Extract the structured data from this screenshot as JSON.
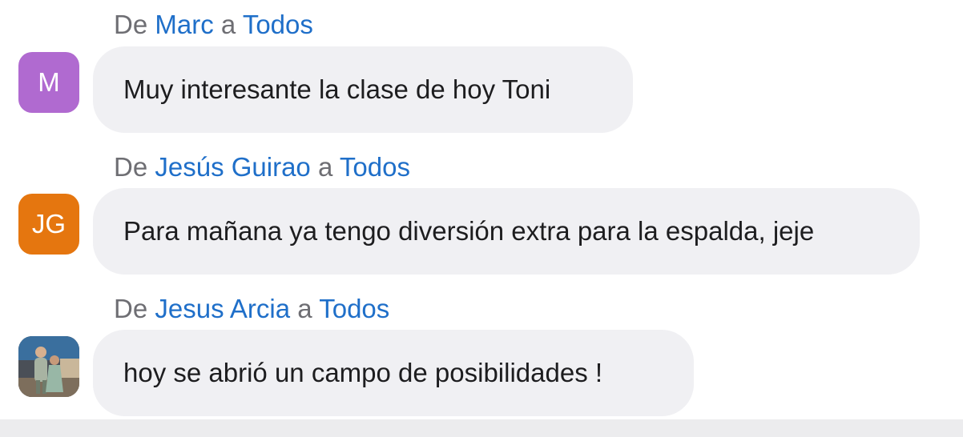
{
  "messages": [
    {
      "from_label": "De",
      "sender": "Marc",
      "to_label": "a",
      "recipient": "Todos",
      "text": "Muy interesante la clase de hoy Toni",
      "avatar_initials": "M",
      "avatar_color": "#b06ad0"
    },
    {
      "from_label": "De",
      "sender": "Jesús Guirao",
      "to_label": "a",
      "recipient": "Todos",
      "text": "Para mañana ya tengo diversión extra para la espalda, jeje",
      "avatar_initials": "JG",
      "avatar_color": "#e5760f"
    },
    {
      "from_label": "De",
      "sender": "Jesus Arcia",
      "to_label": "a",
      "recipient": "Todos",
      "text": "hoy se abrió un campo de posibilidades !",
      "avatar_icon": "user-photo-icon"
    }
  ],
  "colors": {
    "link": "#1f6fc9",
    "meta_text": "#6e6e73",
    "bubble_bg": "#f0f0f3",
    "message_text": "#1d1d1f"
  }
}
